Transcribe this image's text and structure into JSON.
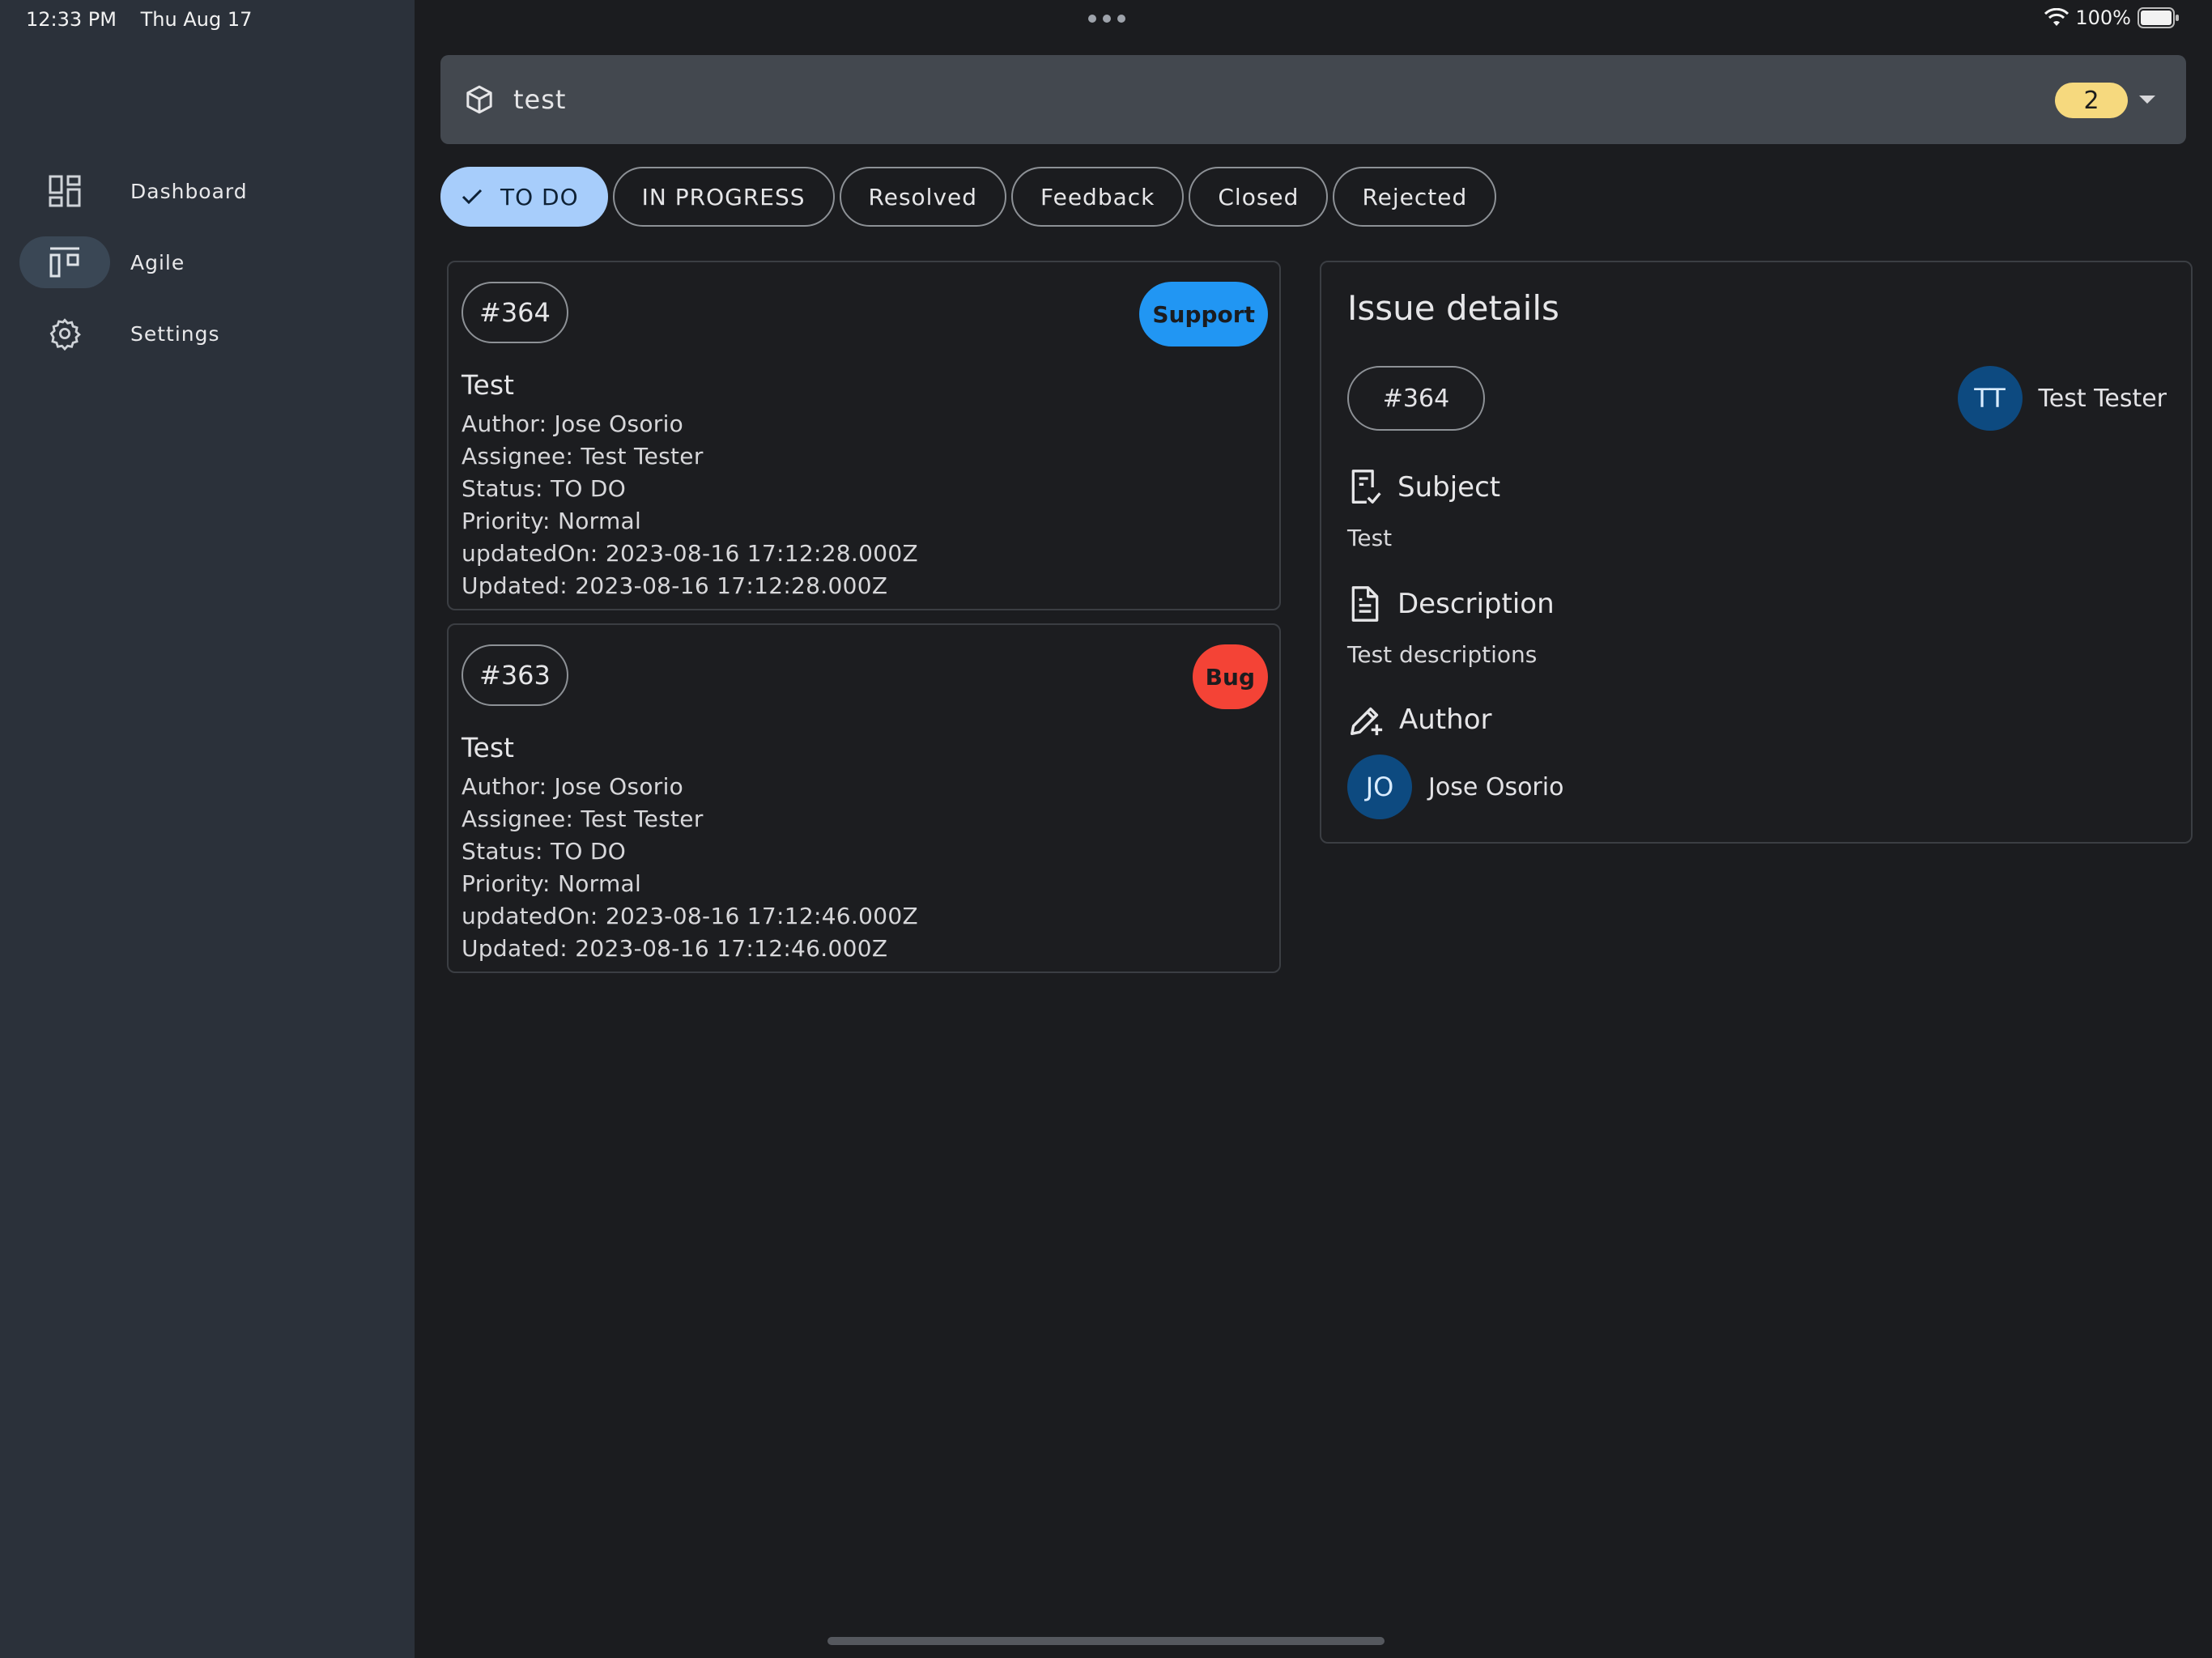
{
  "status_bar": {
    "time": "12:33 PM",
    "date": "Thu Aug 17",
    "battery": "100%"
  },
  "sidebar": {
    "items": [
      {
        "label": "Dashboard",
        "icon": "dashboard-icon",
        "active": false
      },
      {
        "label": "Agile",
        "icon": "agile-board-icon",
        "active": true
      },
      {
        "label": "Settings",
        "icon": "gear-icon",
        "active": false
      }
    ]
  },
  "project": {
    "name": "test",
    "count": "2"
  },
  "filters": [
    {
      "label": "TO DO",
      "selected": true
    },
    {
      "label": "IN PROGRESS",
      "selected": false
    },
    {
      "label": "Resolved",
      "selected": false
    },
    {
      "label": "Feedback",
      "selected": false
    },
    {
      "label": "Closed",
      "selected": false
    },
    {
      "label": "Rejected",
      "selected": false
    }
  ],
  "issues": [
    {
      "id": "#364",
      "tracker": "Support",
      "tracker_color": "#2196f3",
      "title": "Test",
      "author": "Author: Jose Osorio",
      "assignee": "Assignee: Test Tester",
      "status": "Status: TO DO",
      "priority": "Priority: Normal",
      "updated_on": "updatedOn: 2023-08-16 17:12:28.000Z",
      "updated": "Updated: 2023-08-16 17:12:28.000Z"
    },
    {
      "id": "#363",
      "tracker": "Bug",
      "tracker_color": "#f44336",
      "title": "Test",
      "author": "Author: Jose Osorio",
      "assignee": "Assignee: Test Tester",
      "status": "Status: TO DO",
      "priority": "Priority: Normal",
      "updated_on": "updatedOn: 2023-08-16 17:12:46.000Z",
      "updated": "Updated: 2023-08-16 17:12:46.000Z"
    }
  ],
  "details": {
    "title": "Issue details",
    "id": "#364",
    "assignee_initials": "TT",
    "assignee_name": "Test Tester",
    "subject_label": "Subject",
    "subject": "Test",
    "description_label": "Description",
    "description": "Test descriptions",
    "author_label": "Author",
    "author_initials": "JO",
    "author_name": "Jose Osorio"
  }
}
